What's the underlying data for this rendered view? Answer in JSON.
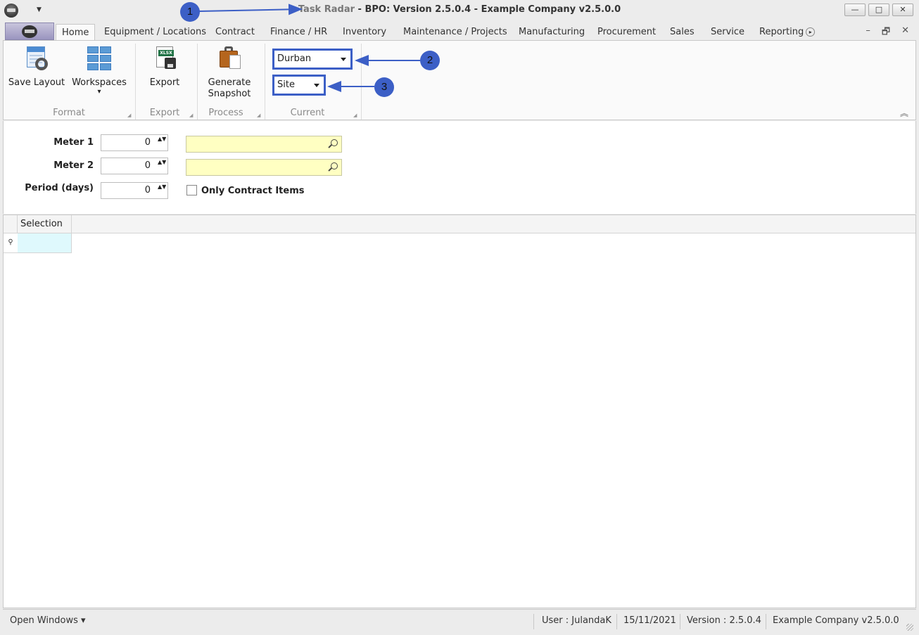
{
  "titlebar": {
    "app_name": "Task Radar",
    "title_rest": " - BPO: Version 2.5.0.4 - Example Company v2.5.0.0",
    "quick_access_glyph": "▼",
    "minimize": "—",
    "maximize": "□",
    "close": "✕"
  },
  "tabs": {
    "items": [
      "Home",
      "Equipment / Locations",
      "Contract",
      "Finance / HR",
      "Inventory",
      "Maintenance / Projects",
      "Manufacturing",
      "Procurement",
      "Sales",
      "Service",
      "Reporting"
    ],
    "active": "Home",
    "scroll_glyph": "▸",
    "mdi_minimize": "–",
    "mdi_restore": "🗗",
    "mdi_close": "✕"
  },
  "ribbon": {
    "save_layout": "Save Layout",
    "workspaces": "Workspaces",
    "workspaces_arrow": "▾",
    "export": "Export",
    "xlsx": "XLSX",
    "generate_line1": "Generate",
    "generate_line2": "Snapshot",
    "groups": {
      "format": "Format",
      "export": "Export",
      "process": "Process",
      "current": "Current"
    },
    "corner_glyph": "◢",
    "collapse_glyph": "︽",
    "location_combo": "Durban",
    "level_combo": "Site"
  },
  "annotations": {
    "one": "1",
    "two": "2",
    "three": "3"
  },
  "filters": {
    "meter1_label": "Meter 1",
    "meter1_value": "0",
    "meter2_label": "Meter 2",
    "meter2_value": "0",
    "period_label": "Period (days)",
    "period_value": "0",
    "spin_glyph": "▲▼",
    "only_contract_label": "Only Contract Items",
    "only_contract_checked": false
  },
  "grid": {
    "columns": [
      "Selection"
    ],
    "filter_row_glyph": "⚲"
  },
  "statusbar": {
    "open_windows": "Open Windows ▾",
    "user": "User : JulandaK",
    "date": "15/11/2021",
    "version": "Version : 2.5.0.4",
    "company": "Example Company v2.5.0.0"
  },
  "colors": {
    "annotation": "#3c5fc6",
    "lookup_bg": "#ffffc2",
    "filter_cell_bg": "#dff9fd"
  }
}
